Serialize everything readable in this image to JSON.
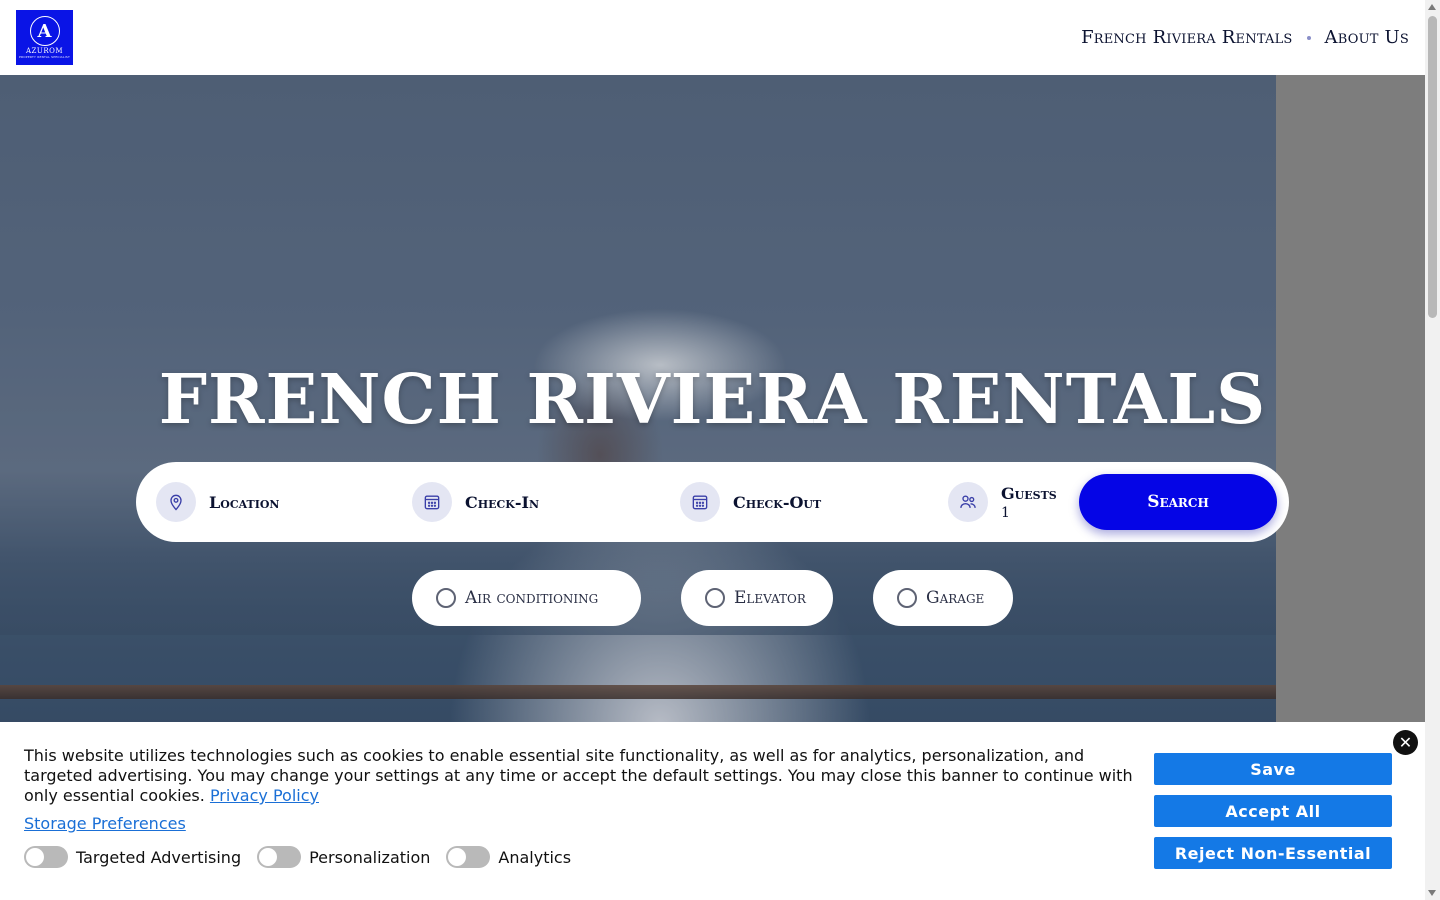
{
  "header": {
    "logo": {
      "monogram": "A",
      "brand": "AZUROM",
      "tagline": "PROPERTY RENTAL SPECIALIST"
    },
    "nav": [
      {
        "label": "French Riviera Rentals"
      },
      {
        "label": "About Us"
      }
    ]
  },
  "hero": {
    "title": "FRENCH RIVIERA RENTALS",
    "search": {
      "location_label": "Location",
      "checkin_label": "Check-In",
      "checkout_label": "Check-Out",
      "guests_label": "Guests",
      "guests_value": "1",
      "button": "Search"
    },
    "filters": [
      {
        "label": "Air conditioning",
        "checked": false
      },
      {
        "label": "Elevator",
        "checked": false
      },
      {
        "label": "Garage",
        "checked": false
      }
    ]
  },
  "cookie_banner": {
    "text": "This website utilizes technologies such as cookies to enable essential site functionality, as well as for analytics, personalization, and targeted advertising. You may change your settings at any time or accept the default settings. You may close this banner to continue with only essential cookies.",
    "privacy_link": "Privacy Policy",
    "storage_link": "Storage Preferences",
    "toggles": [
      {
        "label": "Targeted Advertising",
        "on": false
      },
      {
        "label": "Personalization",
        "on": false
      },
      {
        "label": "Analytics",
        "on": false
      }
    ],
    "buttons": {
      "save": "Save",
      "accept": "Accept All",
      "reject": "Reject Non-Essential"
    },
    "close_icon": "close-icon"
  },
  "colors": {
    "brand_blue": "#0505e6",
    "cookie_button": "#1479e6",
    "link": "#1a6fd6"
  }
}
